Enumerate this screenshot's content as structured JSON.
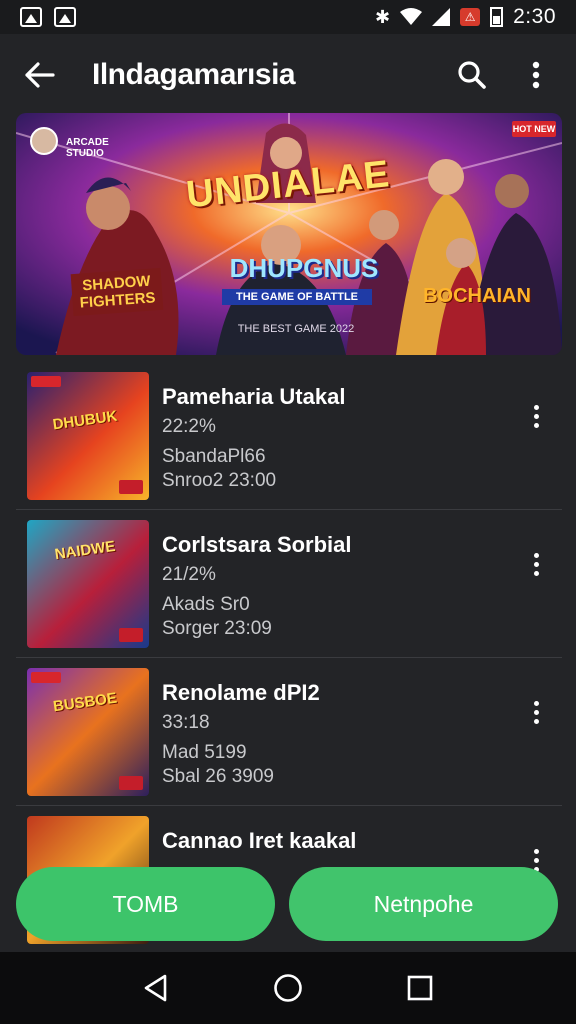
{
  "status_bar": {
    "time": "2:30",
    "alert_badge": "⚠",
    "icons": [
      "image-notification-icon",
      "photo-notification-icon",
      "bluetooth-icon",
      "wifi-icon",
      "signal-icon",
      "alert-icon",
      "battery-icon"
    ]
  },
  "app_bar": {
    "title": "Ilndagamarısia"
  },
  "banner": {
    "title": "UNDIALAE",
    "logo": "DHUPGNUS",
    "tag": "THE GAME OF BATTLE",
    "left_label": "SHADOW FIGHTERS",
    "right_label": "BOCHAIAN",
    "credits": "THE BEST GAME 2022",
    "publisher": "ARCADE STUDIO",
    "badge": "HOT NEW"
  },
  "games": [
    {
      "name": "Pameharia Utakal",
      "meta1": "22:2%",
      "meta2": "SbandaPl66",
      "meta3": "Snroo2 23:00",
      "thumb_label": "DHUBUK",
      "colors": [
        "#2a2170",
        "#e6431f",
        "#f7b52a"
      ]
    },
    {
      "name": "Corlstsara Sorbial",
      "meta1": "21/2%",
      "meta2": "Akads Sr0",
      "meta3": "Sorger 23:09",
      "thumb_label": "NAIDWE",
      "colors": [
        "#1fa6c4",
        "#b81f3a",
        "#173a8c"
      ]
    },
    {
      "name": "Renolame dPI2",
      "meta1": "33:18",
      "meta2": "Mad 5199",
      "meta3": "Sbal 26 3909",
      "thumb_label": "BUSBOE",
      "colors": [
        "#7a2fb0",
        "#e8721e",
        "#2c1f5c"
      ]
    },
    {
      "name": "Cannao Iret kaakal",
      "meta1": "",
      "meta2": "",
      "meta3": "",
      "thumb_label": "",
      "colors": [
        "#c0391e",
        "#f0a22a",
        "#3a1a10"
      ]
    }
  ],
  "buttons": {
    "left": "TOMB",
    "right": "Netnpohe"
  },
  "colors": {
    "background": "#232427",
    "accent_green": "#3dc46a",
    "divider": "#3a3b3f"
  }
}
